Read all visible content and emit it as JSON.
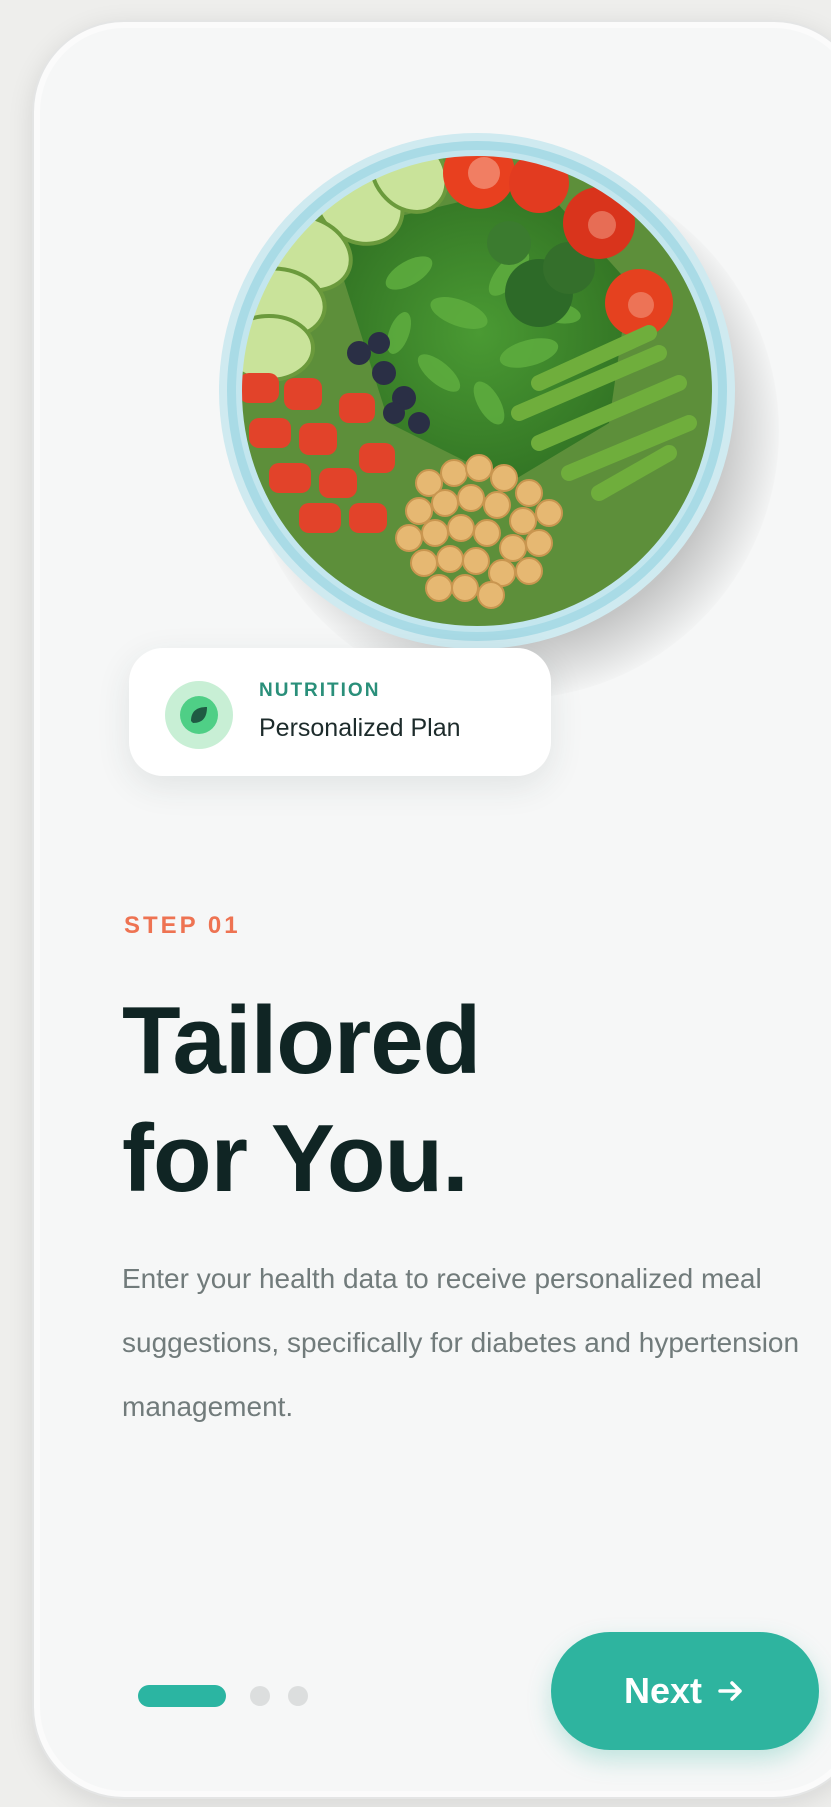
{
  "hero": {
    "image": "vegetable-bowl",
    "colors": {
      "bowl_rim": "#a9dbe6",
      "greens": "#3f8a2f",
      "tomato": "#e23b20",
      "chickpea": "#e6b872",
      "cucumber": "#b9d98a",
      "green_beans": "#6fae3c",
      "blueberry": "#2a2f45"
    }
  },
  "badge": {
    "icon": "leaf-icon",
    "kicker": "NUTRITION",
    "title": "Personalized Plan"
  },
  "onboarding": {
    "step_label": "STEP 01",
    "headline_line1": "Tailored",
    "headline_line2": "for You.",
    "description": "Enter your health data to receive personalized meal suggestions, specifically for diabetes and hypertension management."
  },
  "pager": {
    "total_pages": 3,
    "current_page": 1
  },
  "actions": {
    "next_label": "Next",
    "next_icon": "arrow-right-icon"
  },
  "theme": {
    "accent": "#2eb49f",
    "step_color": "#ee7352",
    "headline_color": "#102524",
    "body_color": "#717b7b",
    "background": "#f6f7f7"
  }
}
